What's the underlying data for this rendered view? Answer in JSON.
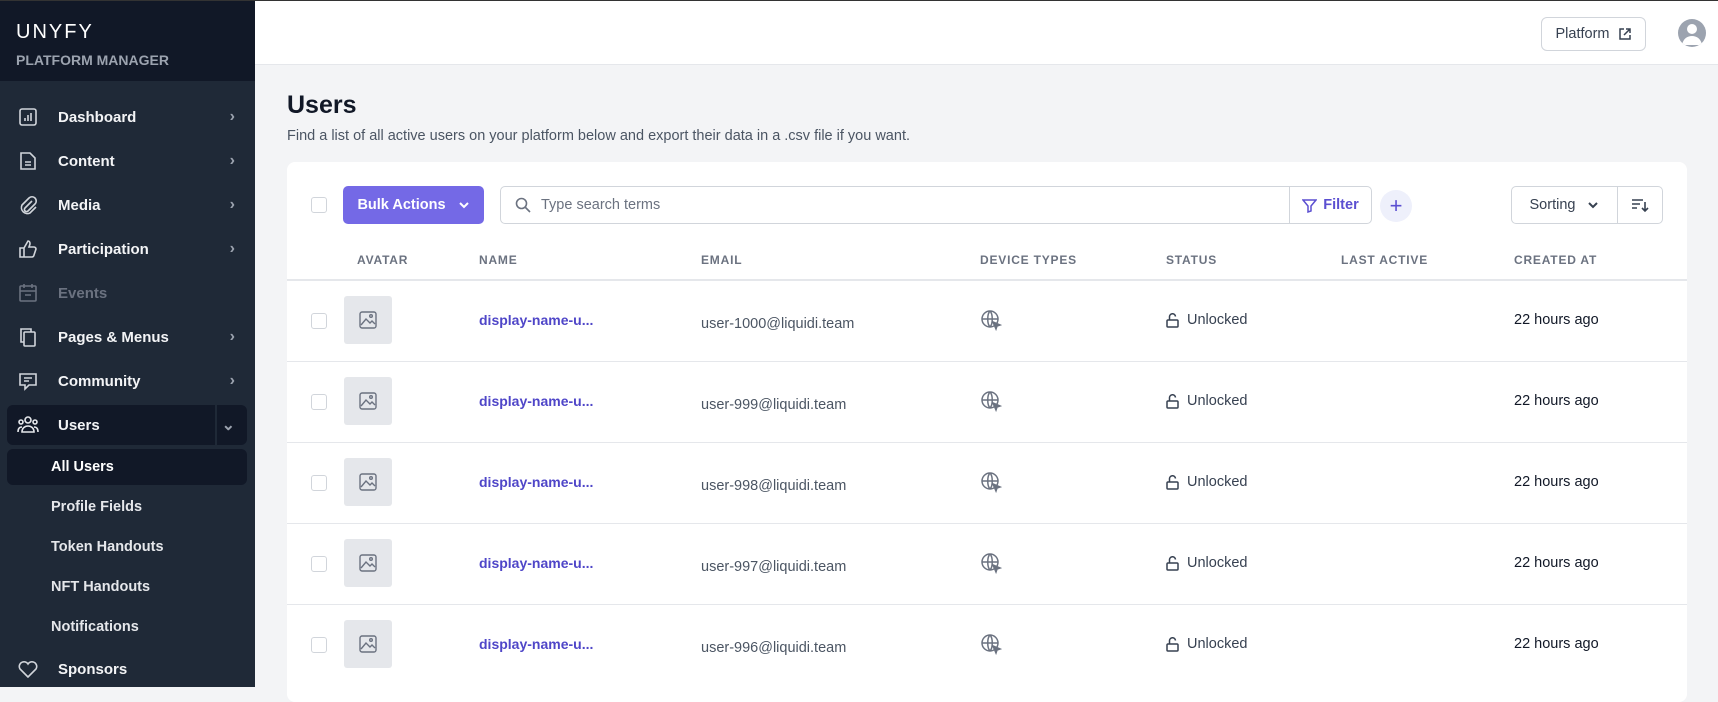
{
  "brand": {
    "title": "UNYFY",
    "subtitle": "PLATFORM MANAGER"
  },
  "sidebar": {
    "items": [
      {
        "label": "Dashboard",
        "icon": "chart-icon"
      },
      {
        "label": "Content",
        "icon": "document-icon"
      },
      {
        "label": "Media",
        "icon": "paperclip-icon"
      },
      {
        "label": "Participation",
        "icon": "thumbs-up-icon"
      },
      {
        "label": "Events",
        "icon": "calendar-icon"
      },
      {
        "label": "Pages & Menus",
        "icon": "pages-icon"
      },
      {
        "label": "Community",
        "icon": "chat-icon"
      },
      {
        "label": "Users",
        "icon": "users-icon"
      }
    ],
    "subitems": [
      "All Users",
      "Profile Fields",
      "Token Handouts",
      "NFT Handouts",
      "Notifications"
    ],
    "sponsors": "Sponsors"
  },
  "header": {
    "platform_label": "Platform"
  },
  "page": {
    "title": "Users",
    "subtitle": "Find a list of all active users on your platform below and export their data in a .csv file if you want."
  },
  "toolbar": {
    "bulk_label": "Bulk Actions",
    "search_placeholder": "Type search terms",
    "filter_label": "Filter",
    "sorting_label": "Sorting"
  },
  "table": {
    "columns": [
      "AVATAR",
      "NAME",
      "EMAIL",
      "DEVICE TYPES",
      "STATUS",
      "LAST ACTIVE",
      "CREATED AT"
    ],
    "rows": [
      {
        "name": "display-name-u...",
        "email": "user-1000@liquidi.team",
        "status": "Unlocked",
        "last_active": "",
        "created": "22 hours ago"
      },
      {
        "name": "display-name-u...",
        "email": "user-999@liquidi.team",
        "status": "Unlocked",
        "last_active": "",
        "created": "22 hours ago"
      },
      {
        "name": "display-name-u...",
        "email": "user-998@liquidi.team",
        "status": "Unlocked",
        "last_active": "",
        "created": "22 hours ago"
      },
      {
        "name": "display-name-u...",
        "email": "user-997@liquidi.team",
        "status": "Unlocked",
        "last_active": "",
        "created": "22 hours ago"
      },
      {
        "name": "display-name-u...",
        "email": "user-996@liquidi.team",
        "status": "Unlocked",
        "last_active": "",
        "created": "22 hours ago"
      }
    ]
  },
  "colors": {
    "accent": "#7469e6",
    "link": "#4f46c8",
    "sidebar": "#1f2937"
  }
}
